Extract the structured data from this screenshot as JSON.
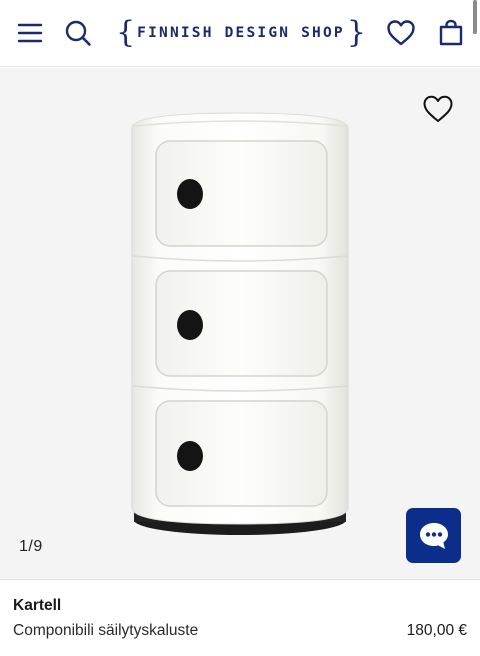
{
  "header": {
    "logo_text": "FINNISH DESIGN SHOP",
    "icons": {
      "menu": "hamburger-menu-icon",
      "search": "search-icon",
      "wishlist": "heart-outline-icon",
      "cart": "shopping-bag-icon"
    },
    "brand_color": "#1a2a6e"
  },
  "gallery": {
    "counter": "1/9",
    "favorite_icon": "heart-outline-icon",
    "chat_icon": "chat-bubble-icon",
    "chat_color": "#0d2d8a",
    "background": "#f4f4f4"
  },
  "product": {
    "brand": "Kartell",
    "name": "Componibili säilytyskaluste",
    "price": "180,00 €"
  }
}
